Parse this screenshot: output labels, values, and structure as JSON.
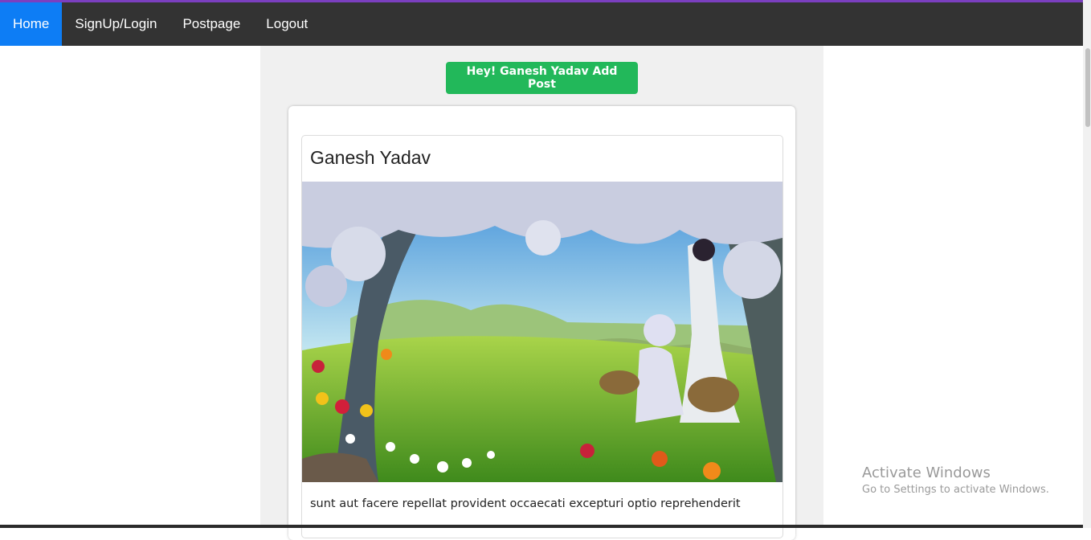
{
  "nav": {
    "items": [
      {
        "label": "Home",
        "active": true
      },
      {
        "label": "SignUp/Login",
        "active": false
      },
      {
        "label": "Postpage",
        "active": false
      },
      {
        "label": "Logout",
        "active": false
      }
    ]
  },
  "add_post_button": "Hey! Ganesh Yadav Add Post",
  "posts": [
    {
      "author": "Ganesh Yadav",
      "image": "spring-garden-illustration",
      "text": "sunt aut facere repellat provident occaecati excepturi optio reprehenderit"
    }
  ],
  "watermark": {
    "title": "Activate Windows",
    "subtitle": "Go to Settings to activate Windows."
  },
  "colors": {
    "navbar": "#333333",
    "nav_active": "#0d7df5",
    "add_button": "#22b85a",
    "top_accent": "#7b3fbf"
  }
}
